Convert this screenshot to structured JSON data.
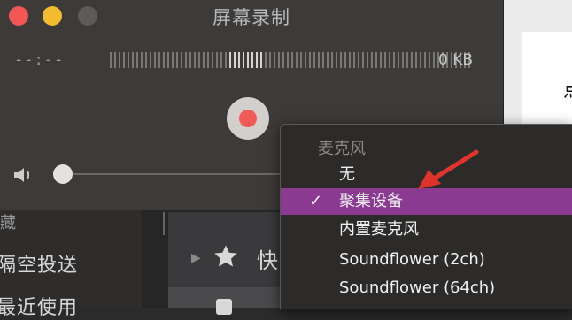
{
  "window": {
    "title": "屏幕录制",
    "timer": "--:--",
    "file_size": "0 KB"
  },
  "controls": {
    "record_icon": "record-icon",
    "speaker_icon": "speaker-icon",
    "volume": 0.0
  },
  "menu": {
    "header": "麦克风",
    "items": [
      {
        "label": "无",
        "selected": false
      },
      {
        "label": "聚集设备",
        "selected": true
      },
      {
        "label": "内置麦克风",
        "selected": false
      },
      {
        "label": "Soundflower (2ch)",
        "selected": false
      },
      {
        "label": "Soundflower (64ch)",
        "selected": false
      }
    ],
    "check_mark": "✓"
  },
  "background": {
    "sidebar_items": [
      "藏",
      "隔空投送",
      "最近使用"
    ],
    "quick_label": "快",
    "right_glyph": "点"
  },
  "colors": {
    "selection": "#8b3a91",
    "record": "#f25a56",
    "annotation_arrow": "#e0332c"
  }
}
